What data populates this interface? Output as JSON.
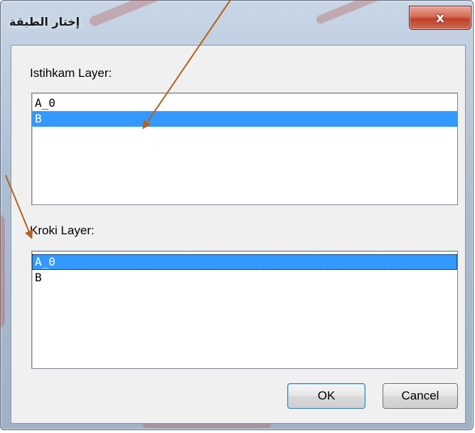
{
  "window": {
    "title": "إختار الطبقة",
    "close_glyph": "x"
  },
  "istihkam": {
    "label": "Istihkam Layer:",
    "items": [
      {
        "label": "A_0",
        "selected": false
      },
      {
        "label": "B",
        "selected": true
      }
    ]
  },
  "kroki": {
    "label": "Kroki Layer:",
    "items": [
      {
        "label": "A_0",
        "selected": true
      },
      {
        "label": "B",
        "selected": false
      }
    ]
  },
  "buttons": {
    "ok_label": "OK",
    "cancel_label": "Cancel"
  },
  "colors": {
    "selection": "#3399ff",
    "annotation_arrow": "#b8601a",
    "close_button": "#c9432c"
  }
}
